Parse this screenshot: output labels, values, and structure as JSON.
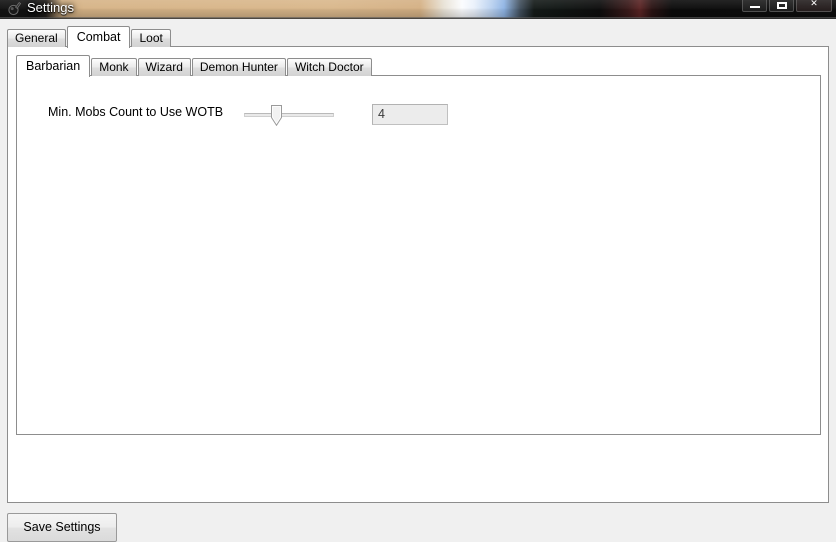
{
  "window": {
    "title": "Settings",
    "icon": "app-icon",
    "controls": [
      {
        "name": "minimize",
        "label": "Minimize",
        "glyph": "minimize-icon"
      },
      {
        "name": "maximize",
        "label": "Maximize",
        "glyph": "maximize-icon"
      },
      {
        "name": "close",
        "label": "Close",
        "glyph": "✕"
      }
    ]
  },
  "outer_tabs": {
    "selected": "Combat",
    "items": [
      {
        "label": "General"
      },
      {
        "label": "Combat"
      },
      {
        "label": "Loot"
      }
    ]
  },
  "inner_tabs": {
    "selected": "Barbarian",
    "items": [
      {
        "label": "Barbarian"
      },
      {
        "label": "Monk"
      },
      {
        "label": "Wizard"
      },
      {
        "label": "Demon Hunter"
      },
      {
        "label": "Witch Doctor"
      }
    ]
  },
  "settings": [
    {
      "label": "Min. Mobs Count to Use WOTB",
      "slider": {
        "value": 4,
        "min": 0,
        "max": 10,
        "percent": 36
      },
      "value_text": "4"
    }
  ],
  "footer": {
    "save_label": "Save Settings"
  },
  "colors": {
    "window_background": "#f0f0f0",
    "panel_background": "#ffffff",
    "border": "#8d8d8d",
    "titlebar_dark": "#0d0d0d",
    "titlebar_glass_tan": "#d6b386",
    "titlebar_glass_blue": "#8fb4e4",
    "title_text": "#ffffff",
    "readonly_field": "#ececec"
  }
}
